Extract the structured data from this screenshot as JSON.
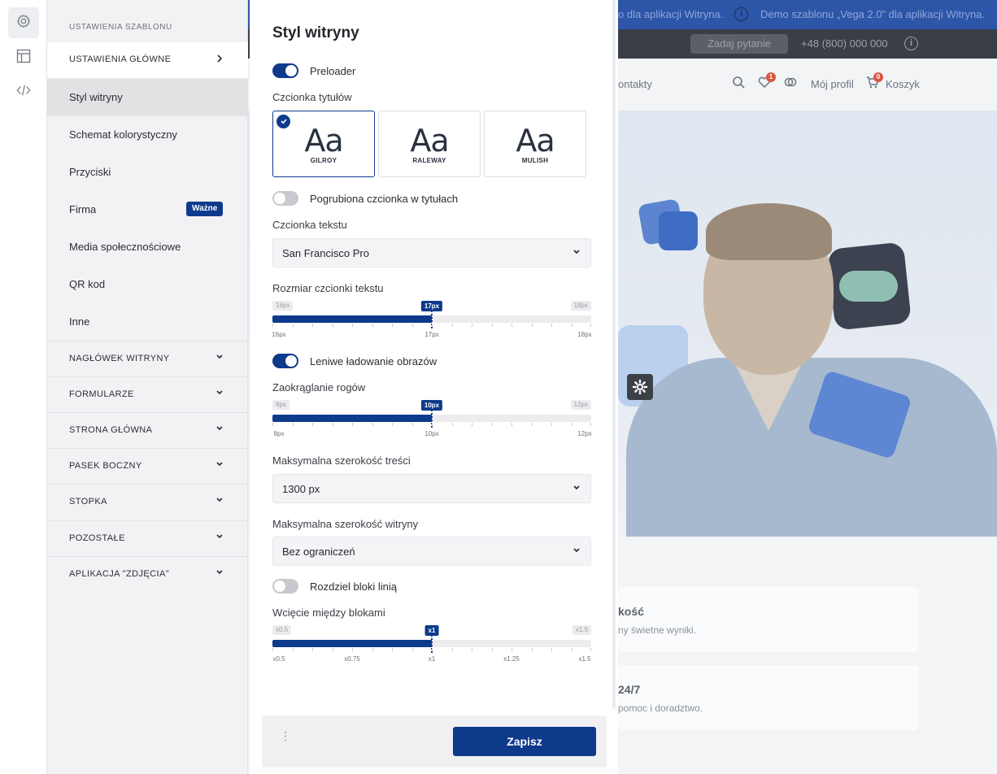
{
  "background": {
    "topbar": {
      "promo_1": "o dla aplikacji Witryna.",
      "promo_2": "Demo szablonu „Vega 2.0” dla aplikacji Witryna.",
      "info_symbol": "i"
    },
    "subbar": {
      "ask_button": "Zadaj pytanie",
      "phone": "+48 (800) 000 000",
      "info_symbol": "i"
    },
    "header": {
      "nav_link": "ontakty",
      "wishlist_count": "1",
      "profile": "Mój profil",
      "cart_count": "0",
      "cart": "Koszyk"
    },
    "cards": [
      {
        "title": "kość",
        "subtitle": "ny świetne wyniki."
      },
      {
        "title": "24/7",
        "subtitle": "pomoc i doradztwo."
      }
    ]
  },
  "rail": {
    "items": [
      {
        "icon": "gear-icon",
        "active": true
      },
      {
        "icon": "layout-icon",
        "active": false
      },
      {
        "icon": "code-icon",
        "active": false
      }
    ]
  },
  "menu": {
    "title": "USTAWIENIA SZABLONU",
    "main_section": "USTAWIENIA GŁÓWNE",
    "items": [
      {
        "label": "Styl witryny",
        "active": true
      },
      {
        "label": "Schemat kolorystyczny"
      },
      {
        "label": "Przyciski"
      },
      {
        "label": "Firma",
        "badge": "Ważne"
      },
      {
        "label": "Media społecznościowe"
      },
      {
        "label": "QR kod"
      },
      {
        "label": "Inne"
      }
    ],
    "sections": [
      "NAGŁÓWEK WITRYNY",
      "FORMULARZE",
      "STRONA GŁÓWNA",
      "PASEK BOCZNY",
      "STOPKA",
      "POZOSTAŁE",
      "APLIKACJA \"ZDJĘCIA\""
    ]
  },
  "panel": {
    "title": "Styl witryny",
    "preloader": {
      "label": "Preloader",
      "on": true
    },
    "heading_font": {
      "label": "Czcionka tytułów",
      "sample": "Aa",
      "options": [
        {
          "name": "GILROY",
          "selected": true
        },
        {
          "name": "RALEWAY",
          "selected": false
        },
        {
          "name": "MULISH",
          "selected": false
        }
      ]
    },
    "bold_headings": {
      "label": "Pogrubiona czcionka w tytułach",
      "on": false
    },
    "text_font": {
      "label": "Czcionka tekstu",
      "value": "San Francisco Pro"
    },
    "font_size": {
      "label": "Rozmiar czcionki tekstu",
      "min": "16px",
      "max": "18px",
      "current": "17px",
      "fraction": 0.5,
      "ticks": [
        "16px",
        "17px",
        "18px"
      ]
    },
    "lazy_load": {
      "label": "Leniwe ładowanie obrazów",
      "on": true
    },
    "radius": {
      "label": "Zaokrąglanie rogów",
      "min": "8px",
      "max": "12px",
      "current": "10px",
      "fraction": 0.5,
      "ticks": [
        "8px",
        "10px",
        "12px"
      ]
    },
    "content_width": {
      "label": "Maksymalna szerokość treści",
      "value": "1300 px"
    },
    "site_width": {
      "label": "Maksymalna szerokość witryny",
      "value": "Bez ograniczeń"
    },
    "divider": {
      "label": "Rozdziel bloki linią",
      "on": false
    },
    "block_gap": {
      "label": "Wcięcie między blokami",
      "min": "x0.5",
      "max": "x1.5",
      "current": "x1",
      "fraction": 0.5,
      "ticks": [
        "x0.5",
        "x0.75",
        "x1",
        "x1.25",
        "x1.5"
      ]
    }
  },
  "footer": {
    "more_symbol": "⋮",
    "save_label": "Zapisz"
  },
  "colors": {
    "accent": "#0e3a8c",
    "topbar": "#2d55a8",
    "badge": "#d9573f"
  }
}
